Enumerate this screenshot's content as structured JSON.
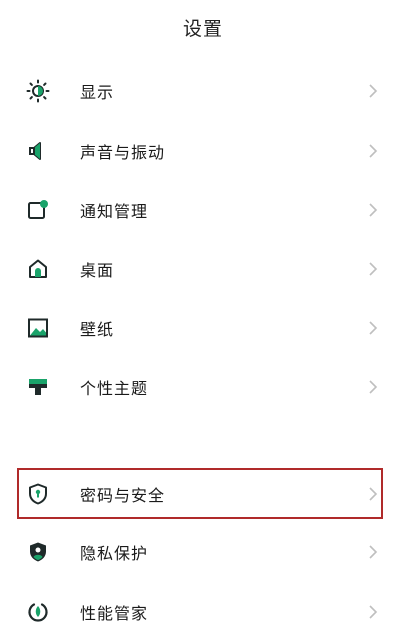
{
  "header": {
    "title": "设置"
  },
  "colors": {
    "accent": "#1aa36a",
    "icon": "#1f2a2a",
    "highlight": "#b02a2a",
    "chevron": "#bfbfbf"
  },
  "settings": {
    "items": [
      {
        "label": "显示",
        "icon": "brightness-icon"
      },
      {
        "label": "声音与振动",
        "icon": "speaker-icon"
      },
      {
        "label": "通知管理",
        "icon": "notification-icon"
      },
      {
        "label": "桌面",
        "icon": "home-icon"
      },
      {
        "label": "壁纸",
        "icon": "wallpaper-icon"
      },
      {
        "label": "个性主题",
        "icon": "theme-icon"
      },
      {
        "label": "密码与安全",
        "icon": "shield-icon"
      },
      {
        "label": "隐私保护",
        "icon": "privacy-icon"
      },
      {
        "label": "性能管家",
        "icon": "performance-icon"
      }
    ]
  }
}
